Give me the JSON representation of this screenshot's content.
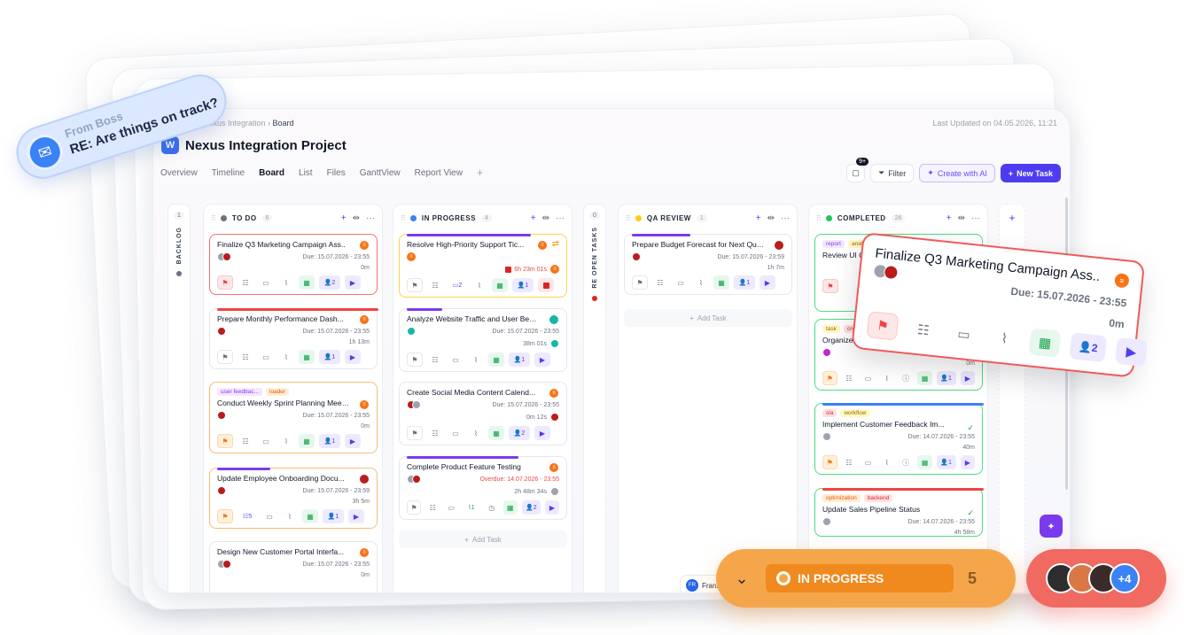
{
  "breadcrumb": {
    "parent": "Nexus Integration",
    "current": "Board"
  },
  "last_updated": "Last Updated on 04.05.2026, 11:21",
  "project": {
    "logo": "W",
    "title": "Nexus Integration Project"
  },
  "tabs": [
    {
      "label": "Overview"
    },
    {
      "label": "Timeline"
    },
    {
      "label": "Board",
      "active": true
    },
    {
      "label": "List"
    },
    {
      "label": "Files"
    },
    {
      "label": "GanttView"
    },
    {
      "label": "Report View"
    }
  ],
  "toolbar": {
    "notif_count": "9+",
    "filter": "Filter",
    "create_ai": "Create with AI",
    "new_task": "New Task"
  },
  "backlog": {
    "label": "BACKLOG",
    "count": "1",
    "color": "#6b7280"
  },
  "reopen": {
    "label": "RE OPEN TASKS",
    "count": "0",
    "color": "#dc2626"
  },
  "columns": {
    "todo": {
      "title": "TO DO",
      "count": "6",
      "color": "#6b7280"
    },
    "inprogress": {
      "title": "IN PROGRESS",
      "count": "4",
      "color": "#3b82f6"
    },
    "qa": {
      "title": "QA REVIEW",
      "count": "1",
      "color": "#facc15"
    },
    "completed": {
      "title": "COMPLETED",
      "count": "26",
      "color": "#22c55e"
    }
  },
  "add_task": "Add Task",
  "cards": {
    "t1": {
      "title": "Finalize Q3 Marketing Campaign Ass..",
      "due": "Due: 15.07.2026 - 23:55",
      "dur": "0m",
      "users": "2"
    },
    "t2": {
      "title": "Prepare Monthly Performance Dash...",
      "due": "Due: 15.07.2026 - 23:55",
      "dur": "1h 13m",
      "users": "1"
    },
    "t3": {
      "title": "Conduct Weekly Sprint Planning Meet...",
      "tag1": "user feedbac...",
      "tag2": "loader",
      "due": "Due: 15.07.2026 - 23:55",
      "dur": "0m",
      "users": "1"
    },
    "t4": {
      "title": "Update Employee Onboarding Docu...",
      "due": "Due: 15.07.2026 - 23:59",
      "dur": "3h 5m",
      "subtasks": "5",
      "users": "1"
    },
    "t5": {
      "title": "Design New Customer Portal Interfa...",
      "due": "Due: 15.07.2026 - 23:55",
      "dur": "0m"
    },
    "p1": {
      "title": "Resolve High-Priority Support Tic...",
      "timer": "6h 23m 01s",
      "comments": "2",
      "users": "1"
    },
    "p2": {
      "title": "Analyze Website Traffic and User Beha...",
      "due": "Due: 15.07.2026 - 23:55",
      "dur": "38m 01s",
      "users": "1"
    },
    "p3": {
      "title": "Create Social Media Content Calend...",
      "due": "Due: 15.07.2026 - 23:55",
      "dur": "0m 12s",
      "users": "2"
    },
    "p4": {
      "title": "Complete Product Feature Testing",
      "due": "Overdue: 14.07.2026 - 23:55",
      "dur": "2h 48m 34s",
      "attach": "1",
      "users": "2"
    },
    "q1": {
      "title": "Prepare Budget Forecast for Next Quar...",
      "due": "Due: 15.07.2026 - 23:59",
      "dur": "1h 7m",
      "users": "1"
    },
    "c1": {
      "title": "Review UI Con...",
      "tag1": "report",
      "tag2": "analy..."
    },
    "c2": {
      "title": "Organize Proj...",
      "tag1": "task",
      "tag2": "cre...",
      "dur": "0m",
      "users": "1"
    },
    "c3": {
      "title": "Implement Customer Feedback Im...",
      "tag1": "sla",
      "tag2": "workflow",
      "due": "Due: 14.07.2026 - 23:55",
      "dur": "40m",
      "users": "1"
    },
    "c4": {
      "title": "Update Sales Pipeline Status",
      "tag1": "optimization",
      "tag2": "backend",
      "due": "Due: 14.07.2026 - 23:55",
      "dur": "4h 58m",
      "users": "1"
    }
  },
  "user_chip": {
    "initials": "FR",
    "name": "Franz"
  },
  "boss_notification": {
    "from": "From Boss",
    "subject": "RE: Are things on track?"
  },
  "zoom_card": {
    "title": "Finalize Q3 Marketing Campaign Ass..",
    "due": "Due: 15.07.2026 - 23:55",
    "dur": "0m",
    "users": "2"
  },
  "status_float": {
    "label": "IN PROGRESS",
    "count": "5"
  },
  "avatars_float": {
    "more": "+4"
  },
  "icons": {
    "flag": "flag-icon",
    "checklist": "checklist-icon",
    "comment": "comment-icon",
    "attach": "paperclip-icon",
    "calendar": "calendar-icon",
    "user": "user-icon",
    "play": "play-icon"
  }
}
